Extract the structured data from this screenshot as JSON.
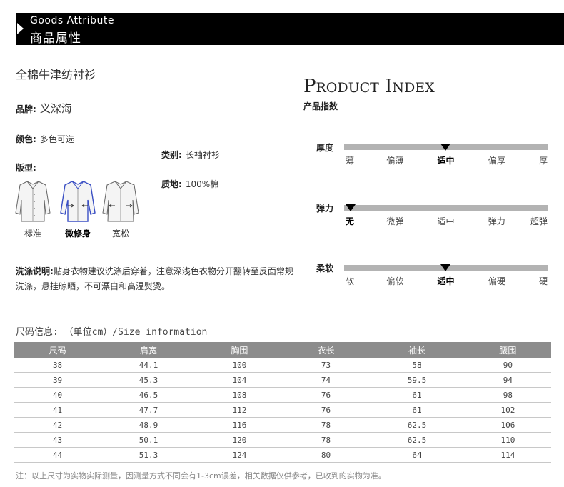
{
  "header": {
    "title_en": "Goods Attribute",
    "title_cn": "商品属性"
  },
  "product": {
    "name": "全棉牛津纺衬衫",
    "brand_label": "品牌:",
    "brand_value": "义深海",
    "color_label": "颜色:",
    "color_value": "多色可选",
    "category_label": "类别:",
    "category_value": "长袖衬衫",
    "fit_label": "版型:",
    "material_label": "质地:",
    "material_value": "100%棉",
    "fits": [
      {
        "label": "标准",
        "selected": false
      },
      {
        "label": "微修身",
        "selected": true
      },
      {
        "label": "宽松",
        "selected": false
      }
    ],
    "care_label": "洗涤说明:",
    "care_text": "贴身衣物建议洗涤后穿着，注意深浅色衣物分开翻转至反面常规洗涤，悬挂晾晒，不可漂白和高温熨烫。"
  },
  "product_index": {
    "title": "PRODUCT INDEX",
    "subtitle": "产品指数",
    "scales": [
      {
        "label": "厚度",
        "ticks": [
          "薄",
          "偏薄",
          "适中",
          "偏厚",
          "厚"
        ],
        "selected": 2
      },
      {
        "label": "弹力",
        "ticks": [
          "无",
          "微弹",
          "适中",
          "弹力",
          "超弹"
        ],
        "selected": 0
      },
      {
        "label": "柔软",
        "ticks": [
          "软",
          "偏软",
          "适中",
          "偏硬",
          "硬"
        ],
        "selected": 2
      }
    ]
  },
  "size_info": {
    "heading": "尺码信息: （单位cm）/Size information",
    "columns": [
      "尺码",
      "肩宽",
      "胸围",
      "衣长",
      "袖长",
      "腰围"
    ],
    "rows": [
      [
        "38",
        "44.1",
        "100",
        "73",
        "58",
        "90"
      ],
      [
        "39",
        "45.3",
        "104",
        "74",
        "59.5",
        "94"
      ],
      [
        "40",
        "46.5",
        "108",
        "76",
        "61",
        "98"
      ],
      [
        "41",
        "47.7",
        "112",
        "76",
        "61",
        "102"
      ],
      [
        "42",
        "48.9",
        "116",
        "78",
        "62.5",
        "106"
      ],
      [
        "43",
        "50.1",
        "120",
        "78",
        "62.5",
        "110"
      ],
      [
        "44",
        "51.3",
        "124",
        "80",
        "64",
        "114"
      ]
    ],
    "note": "注：以上尺寸为实物实际测量，因测量方式不同会有1-3cm误差，相关数据仅供参考，已收到的实物为准。"
  },
  "colors": {
    "header_bg": "#000000",
    "table_header": "#8c8c8c",
    "scale_bar": "#b3b3b3",
    "fit_highlight": "#3a4fc4"
  }
}
